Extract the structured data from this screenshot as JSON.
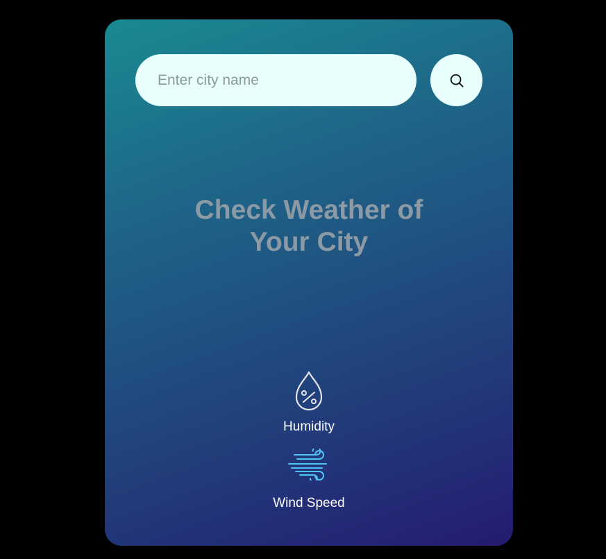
{
  "search": {
    "placeholder": "Enter city name",
    "value": "",
    "button_icon": "search-icon"
  },
  "placeholder_title": {
    "line1": "Check Weather of",
    "line2": "Your City"
  },
  "details": {
    "humidity": {
      "label": "Humidity",
      "icon": "humidity-icon"
    },
    "wind": {
      "label": "Wind Speed",
      "icon": "wind-icon"
    }
  },
  "colors": {
    "page_background": "#000000",
    "gradient_start": "#1a8a91",
    "gradient_end": "#241b72",
    "input_background": "#e8fffd",
    "title_color": "#8c9aa6",
    "wind_icon_color": "#4fc3f7",
    "label_color": "#ffffff"
  }
}
